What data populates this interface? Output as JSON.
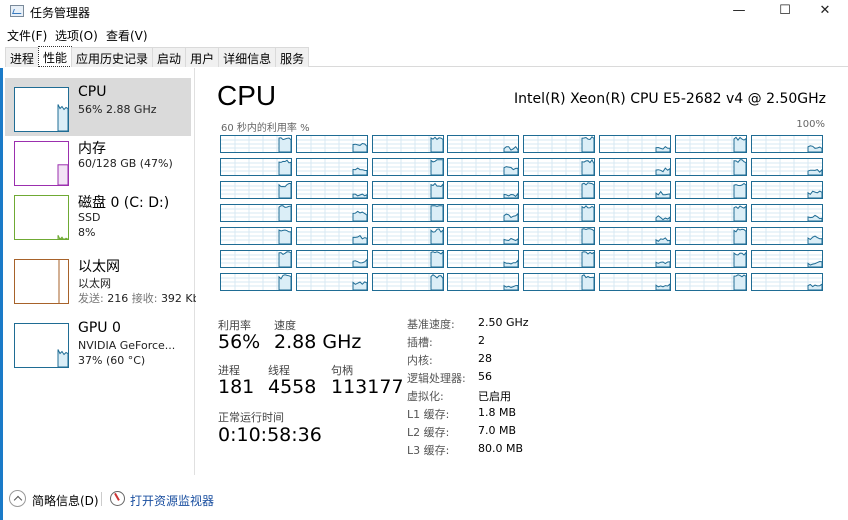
{
  "window": {
    "title": "任务管理器",
    "minimize_icon": "minimize-icon",
    "maximize_icon": "maximize-icon",
    "close_icon": "close-icon",
    "minimize_glyph": "—",
    "maximize_glyph": "☐",
    "close_glyph": "✕"
  },
  "menu": [
    "文件(F)",
    "选项(O)",
    "查看(V)"
  ],
  "tabs": [
    {
      "label": "进程",
      "active": false
    },
    {
      "label": "性能",
      "active": true
    },
    {
      "label": "应用历史记录",
      "active": false
    },
    {
      "label": "启动",
      "active": false
    },
    {
      "label": "用户",
      "active": false
    },
    {
      "label": "详细信息",
      "active": false
    },
    {
      "label": "服务",
      "active": false
    }
  ],
  "sidebar": {
    "items": [
      {
        "title": "CPU",
        "sub1": "56% 2.88 GHz",
        "sub2": "",
        "sub3": "",
        "color": "#1f6c94",
        "fill": "#dbeef7",
        "utilization": 0.56
      },
      {
        "title": "内存",
        "sub1": "60/128 GB (47%)",
        "sub2": "",
        "sub3": "",
        "color": "#9b2fae",
        "fill": "#f2e3f5",
        "utilization": 0.47
      },
      {
        "title": "磁盘 0 (C: D:)",
        "sub1": "SSD",
        "sub2": "8%",
        "sub3": "",
        "color": "#6faa34",
        "fill": "#eaf5dd",
        "utilization": 0.08
      },
      {
        "title": "以太网",
        "sub1": "以太网",
        "sub2_label": "发送:",
        "sub2_send": "216",
        "sub2_recv_label": "接收:",
        "sub2_recv": "392 Kb",
        "color": "#a7622a",
        "fill": "#f7ece2",
        "utilization": 0.0
      },
      {
        "title": "GPU 0",
        "sub1": "NVIDIA GeForce...",
        "sub2": "37% (60 °C)",
        "sub3": "",
        "color": "#1f6c94",
        "fill": "#dbeef7",
        "utilization": 0.37
      }
    ]
  },
  "main": {
    "title": "CPU",
    "model": "Intel(R) Xeon(R) CPU E5-2682 v4 @ 2.50GHz",
    "graph_label_left": "60 秒内的利用率 %",
    "graph_label_right": "100%",
    "logical_processor_count": 56,
    "processor_graph_columns": 8,
    "accent_color": "#1f6c94",
    "stats": {
      "utilization_label": "利用率",
      "utilization_value": "56%",
      "speed_label": "速度",
      "speed_value": "2.88 GHz",
      "processes_label": "进程",
      "processes_value": "181",
      "threads_label": "线程",
      "threads_value": "4558",
      "handles_label": "句柄",
      "handles_value": "113177",
      "uptime_label": "正常运行时间",
      "uptime_value": "0:10:58:36"
    },
    "info": [
      {
        "label": "基准速度:",
        "value": "2.50 GHz"
      },
      {
        "label": "插槽:",
        "value": "2"
      },
      {
        "label": "内核:",
        "value": "28"
      },
      {
        "label": "逻辑处理器:",
        "value": "56"
      },
      {
        "label": "虚拟化:",
        "value": "已启用"
      },
      {
        "label": "L1 缓存:",
        "value": "1.8 MB"
      },
      {
        "label": "L2 缓存:",
        "value": "7.0 MB"
      },
      {
        "label": "L3 缓存:",
        "value": "80.0 MB"
      }
    ]
  },
  "footer": {
    "summary_label": "简略信息(D)",
    "resmon_label": "打开资源监视器",
    "link_color": "#1a4fa0"
  }
}
